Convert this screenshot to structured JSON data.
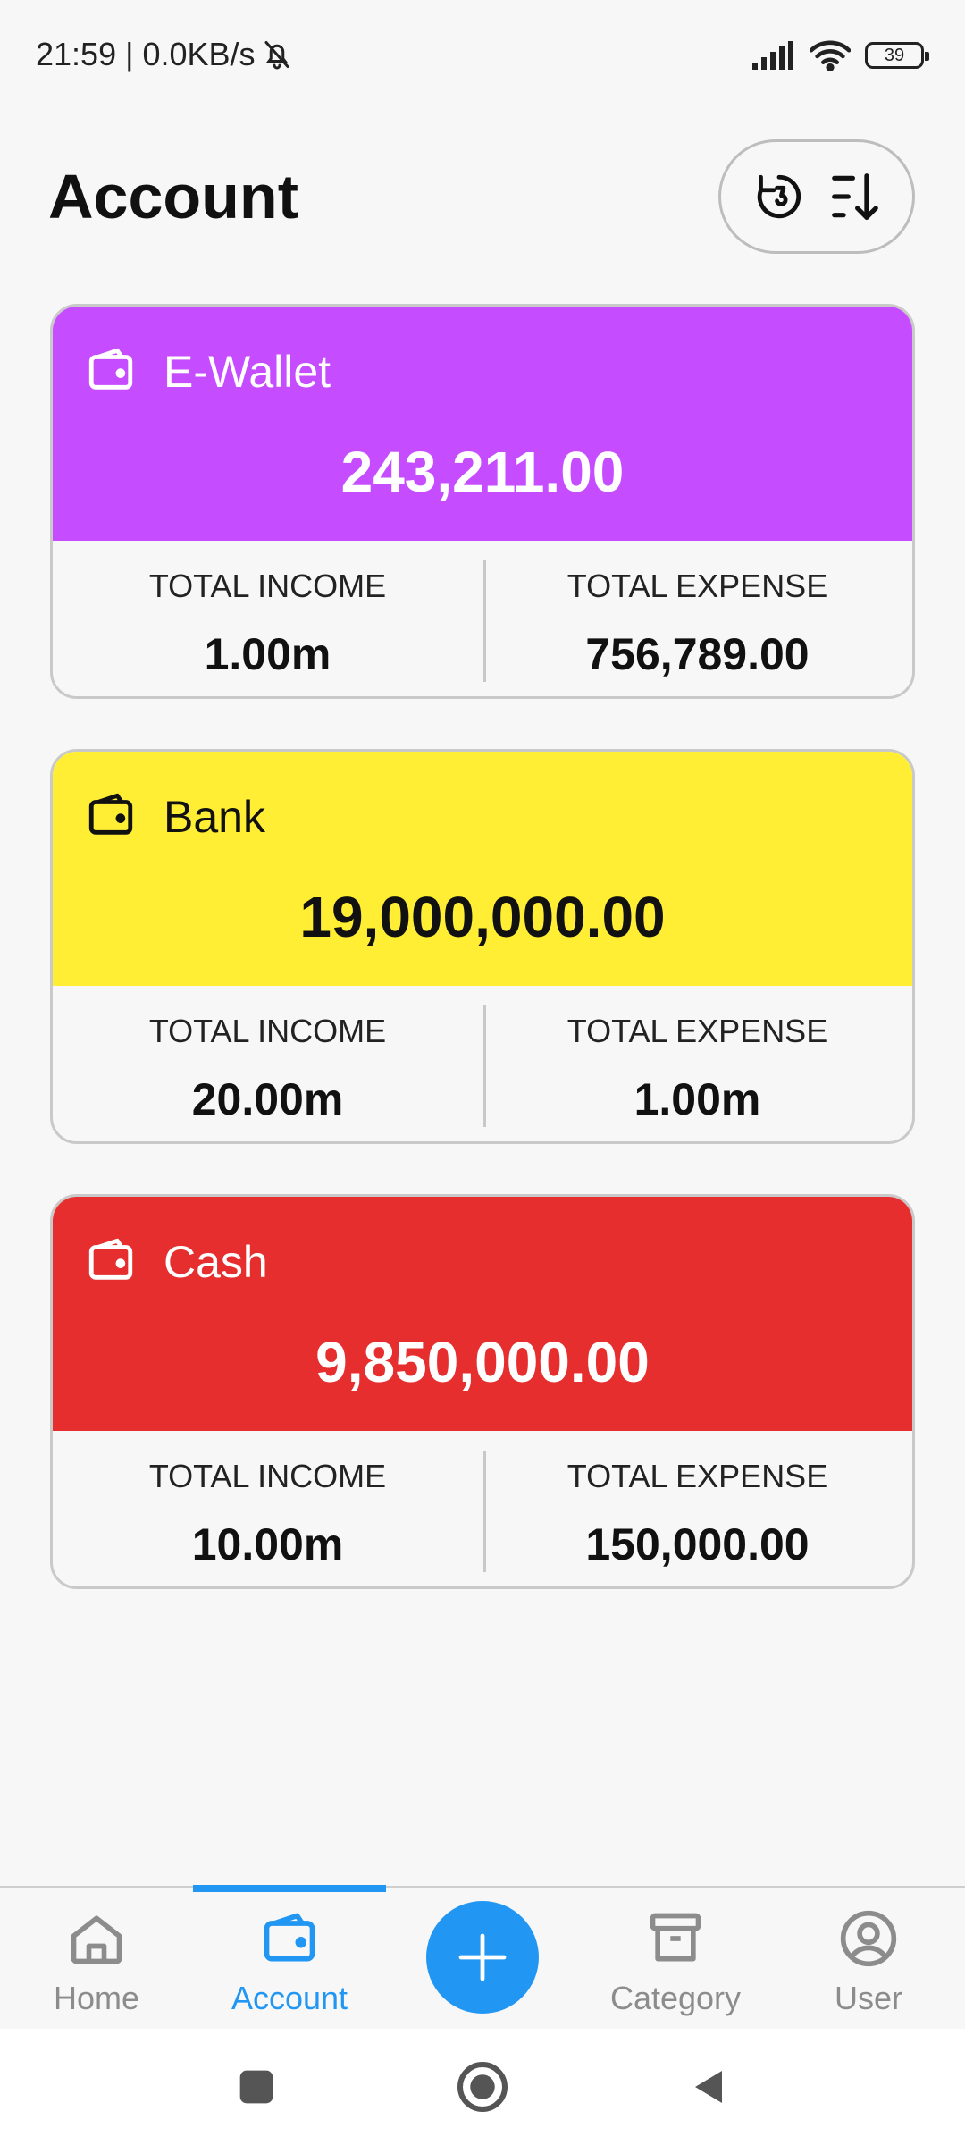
{
  "status_bar": {
    "time_speed": "21:59 | 0.0KB/s",
    "battery": "39",
    "icons": [
      "bell-off-icon",
      "signal-icon",
      "wifi-icon",
      "battery-icon"
    ]
  },
  "header": {
    "title": "Account",
    "actions": [
      "reset-icon",
      "sort-icon"
    ]
  },
  "accounts": [
    {
      "name": "E-Wallet",
      "balance": "243,211.00",
      "income_label": "TOTAL INCOME",
      "income": "1.00m",
      "expense_label": "TOTAL EXPENSE",
      "expense": "756,789.00",
      "color": "#c54cff",
      "text_color": "#ffffff"
    },
    {
      "name": "Bank",
      "balance": "19,000,000.00",
      "income_label": "TOTAL INCOME",
      "income": "20.00m",
      "expense_label": "TOTAL EXPENSE",
      "expense": "1.00m",
      "color": "#ffee33",
      "text_color": "#111111"
    },
    {
      "name": "Cash",
      "balance": "9,850,000.00",
      "income_label": "TOTAL INCOME",
      "income": "10.00m",
      "expense_label": "TOTAL EXPENSE",
      "expense": "150,000.00",
      "color": "#e62e2e",
      "text_color": "#ffffff"
    }
  ],
  "bottom_nav": {
    "items": [
      {
        "label": "Home",
        "icon": "home-icon"
      },
      {
        "label": "Account",
        "icon": "wallet-icon",
        "active": true
      },
      {
        "label": "Category",
        "icon": "archive-icon"
      },
      {
        "label": "User",
        "icon": "user-icon"
      }
    ],
    "fab_icon": "plus-icon",
    "accent": "#2196f3",
    "inactive_color": "#8c8c8c"
  },
  "system_nav": [
    "recents-icon",
    "home-circle-icon",
    "back-icon"
  ]
}
